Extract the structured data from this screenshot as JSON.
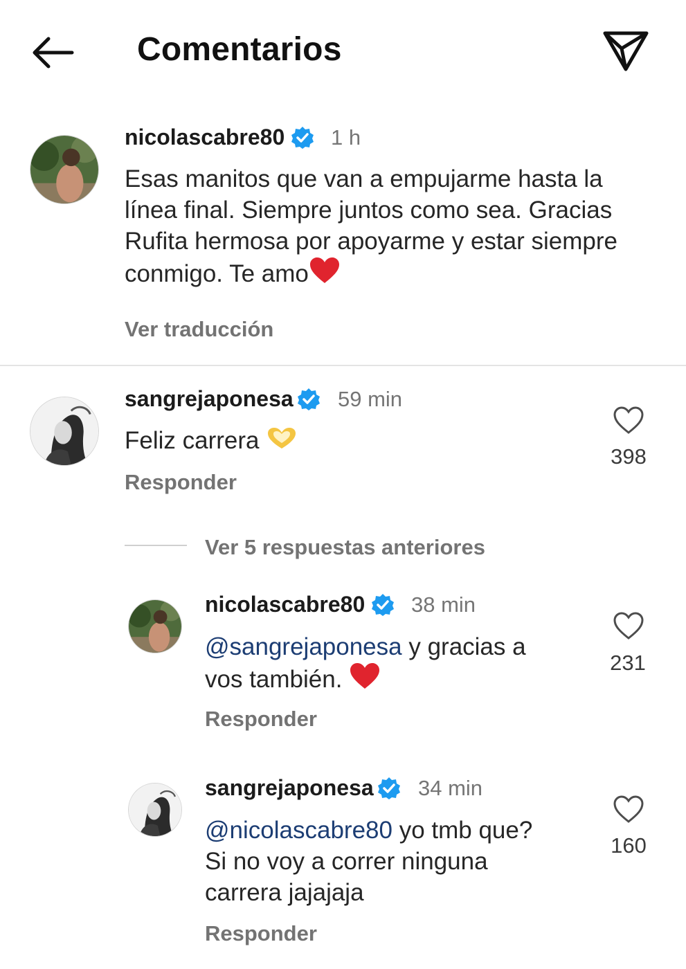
{
  "header": {
    "title": "Comentarios",
    "back_icon": "arrow-left-icon",
    "share_icon": "paper-plane-icon"
  },
  "caption": {
    "username": "nicolascabre80",
    "time": "1 h",
    "text": "Esas manitos que van a empujarme hasta la línea final.  Siempre juntos como sea. Gracias Rufita hermosa por apoyarme y estar siempre conmigo. Te amo",
    "emoji": "heart-icon",
    "translate_label": "Ver traducción"
  },
  "comment1": {
    "username": "sangrejaponesa",
    "time": "59 min",
    "text": "Feliz carrera ",
    "emoji": "heart-hands-icon",
    "reply_label": "Responder",
    "likes": "398"
  },
  "view_replies": {
    "label": "Ver 5 respuestas anteriores"
  },
  "reply1": {
    "username": "nicolascabre80",
    "time": "38 min",
    "mention": "@sangrejaponesa",
    "text_line1": " y gracias a",
    "text_line2": "vos también. ",
    "emoji": "heart-icon",
    "reply_label": "Responder",
    "likes": "231"
  },
  "reply2": {
    "username": "sangrejaponesa",
    "time": "34 min",
    "mention": "@nicolascabre80",
    "text_line1": " yo tmb que?",
    "text_line2": "Si no voy a correr ninguna",
    "text_line3": "carrera jajajaja",
    "reply_label": "Responder",
    "likes": "160"
  },
  "colors": {
    "verified": "#1d9bf0",
    "heart": "#e0242e",
    "mention": "#1c3d73",
    "muted": "#737373"
  }
}
